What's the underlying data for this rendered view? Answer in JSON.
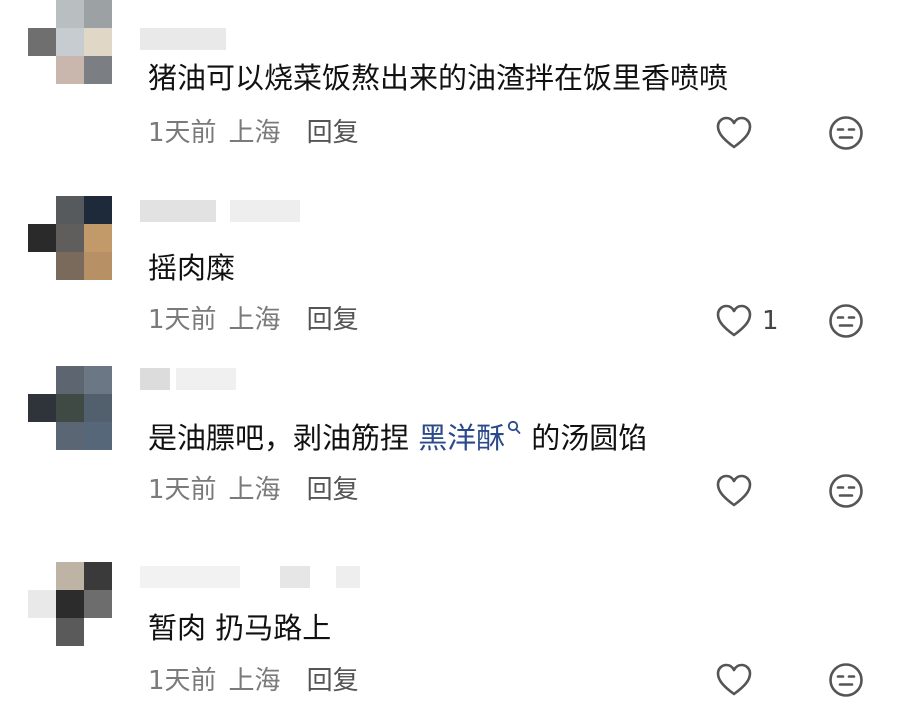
{
  "colors": {
    "text_primary": "#111111",
    "text_meta": "#7a7a7a",
    "link": "#2b4a8b",
    "icon_stroke": "#555555"
  },
  "comments": [
    {
      "text": "猪油可以烧菜饭熬出来的油渣拌在饭里香喷喷",
      "time": "1天前",
      "location": "上海",
      "reply_label": "回复",
      "like_count": "",
      "like_icon": "heart-outline",
      "dislike_icon": "meh-face"
    },
    {
      "text": "摇肉糜",
      "time": "1天前",
      "location": "上海",
      "reply_label": "回复",
      "like_count": "1",
      "like_icon": "heart-outline",
      "dislike_icon": "meh-face"
    },
    {
      "text_before": "是油膘吧，剥油筋捏 ",
      "link_text": "黑洋酥",
      "link_icon": "search-icon",
      "text_after": "的汤圆馅",
      "time": "1天前",
      "location": "上海",
      "reply_label": "回复",
      "like_count": "",
      "like_icon": "heart-outline",
      "dislike_icon": "meh-face"
    },
    {
      "text": "暂肉 扔马路上",
      "time": "1天前",
      "location": "上海",
      "reply_label": "回复",
      "like_count": "",
      "like_icon": "heart-outline",
      "dislike_icon": "meh-face"
    }
  ]
}
